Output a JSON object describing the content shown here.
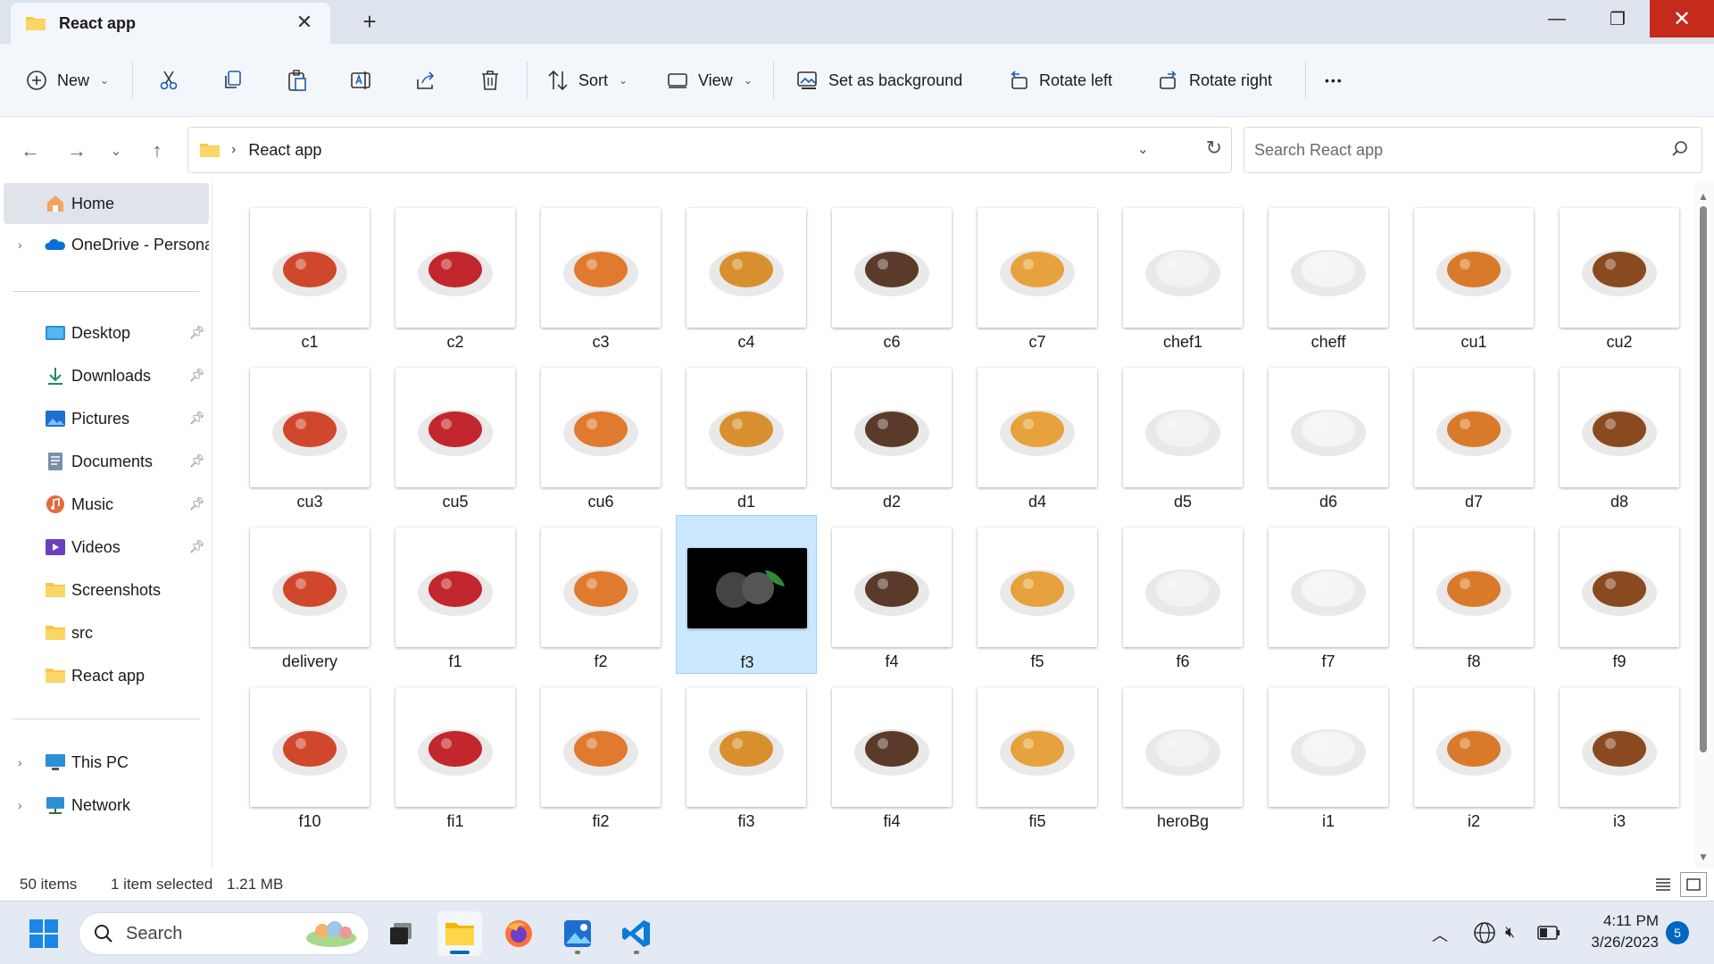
{
  "window": {
    "tab_title": "React app",
    "tab_close": "✕",
    "new_tab": "+",
    "minimize": "—",
    "maximize": "❐",
    "close": "✕"
  },
  "toolbar": {
    "new_label": "New",
    "sort_label": "Sort",
    "view_label": "View",
    "set_bg_label": "Set as background",
    "rotate_left_label": "Rotate left",
    "rotate_right_label": "Rotate right",
    "more_label": "•••"
  },
  "address": {
    "crumb": "React app",
    "search_placeholder": "Search React app"
  },
  "sidebar": {
    "items": [
      {
        "label": "Home",
        "icon": "home-icon"
      },
      {
        "label": "OneDrive - Persona",
        "icon": "onedrive-icon"
      },
      {
        "label": "Desktop",
        "icon": "desktop-icon"
      },
      {
        "label": "Downloads",
        "icon": "downloads-icon"
      },
      {
        "label": "Pictures",
        "icon": "pictures-icon"
      },
      {
        "label": "Documents",
        "icon": "documents-icon"
      },
      {
        "label": "Music",
        "icon": "music-icon"
      },
      {
        "label": "Videos",
        "icon": "videos-icon"
      },
      {
        "label": "Screenshots",
        "icon": "folder-icon"
      },
      {
        "label": "src",
        "icon": "folder-icon"
      },
      {
        "label": "React app",
        "icon": "folder-icon"
      },
      {
        "label": "This PC",
        "icon": "pc-icon"
      },
      {
        "label": "Network",
        "icon": "network-icon"
      }
    ]
  },
  "files": [
    {
      "name": "c1"
    },
    {
      "name": "c2"
    },
    {
      "name": "c3"
    },
    {
      "name": "c4"
    },
    {
      "name": "c6"
    },
    {
      "name": "c7"
    },
    {
      "name": "chef1"
    },
    {
      "name": "cheff"
    },
    {
      "name": "cu1"
    },
    {
      "name": "cu2"
    },
    {
      "name": "cu3"
    },
    {
      "name": "cu5"
    },
    {
      "name": "cu6"
    },
    {
      "name": "d1"
    },
    {
      "name": "d2"
    },
    {
      "name": "d4"
    },
    {
      "name": "d5"
    },
    {
      "name": "d6"
    },
    {
      "name": "d7"
    },
    {
      "name": "d8"
    },
    {
      "name": "delivery"
    },
    {
      "name": "f1"
    },
    {
      "name": "f2"
    },
    {
      "name": "f3"
    },
    {
      "name": "f4"
    },
    {
      "name": "f5"
    },
    {
      "name": "f6"
    },
    {
      "name": "f7"
    },
    {
      "name": "f8"
    },
    {
      "name": "f9"
    },
    {
      "name": "f10"
    },
    {
      "name": "fi1"
    },
    {
      "name": "fi2"
    },
    {
      "name": "fi3"
    },
    {
      "name": "fi4"
    },
    {
      "name": "fi5"
    },
    {
      "name": "heroBg"
    },
    {
      "name": "i1"
    },
    {
      "name": "i2"
    },
    {
      "name": "i3"
    }
  ],
  "selected_file": "f3",
  "status": {
    "count": "50 items",
    "selection": "1 item selected",
    "size": "1.21 MB"
  },
  "taskbar": {
    "search_label": "Search",
    "time": "4:11 PM",
    "date": "3/26/2023",
    "notifications": "5"
  },
  "colors": {
    "selection": "#cce8ff",
    "accent": "#0067c0",
    "close_red": "#c42b1c",
    "folder": "#f7c948"
  }
}
